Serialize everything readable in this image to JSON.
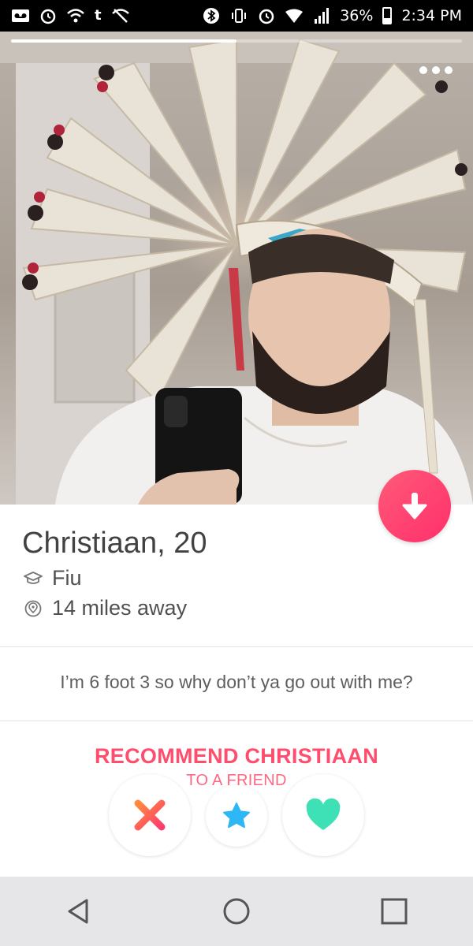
{
  "status_bar": {
    "left_icons": [
      "voicemail-icon",
      "alarm-icon",
      "wifi-calling-icon",
      "tumblr-icon",
      "no-signal-icon"
    ],
    "battery_percent": "36%",
    "battery_level": 0.36,
    "time": "2:34 PM"
  },
  "photo": {
    "photo_index": 1,
    "photo_count": 2
  },
  "profile": {
    "name_age": "Christiaan, 20",
    "school": "Fiu",
    "distance": "14 miles away",
    "bio": "I’m 6 foot 3 so why don’t ya go out with me?"
  },
  "recommend": {
    "line1": "RECOMMEND CHRISTIAAN",
    "line2": "TO A FRIEND"
  },
  "actions": [
    {
      "name": "nope",
      "icon": "x-icon",
      "color": "#ff6a4d"
    },
    {
      "name": "super-like",
      "icon": "star-icon",
      "color": "#2db7f5"
    },
    {
      "name": "like",
      "icon": "heart-icon",
      "color": "#3ee0b5"
    }
  ],
  "colors": {
    "accent_gradient_start": "#ff5a7a",
    "accent_gradient_end": "#ff2f6a",
    "recommend_text": "#ff4d6d"
  },
  "nav": [
    "back-icon",
    "home-icon",
    "recents-icon"
  ]
}
